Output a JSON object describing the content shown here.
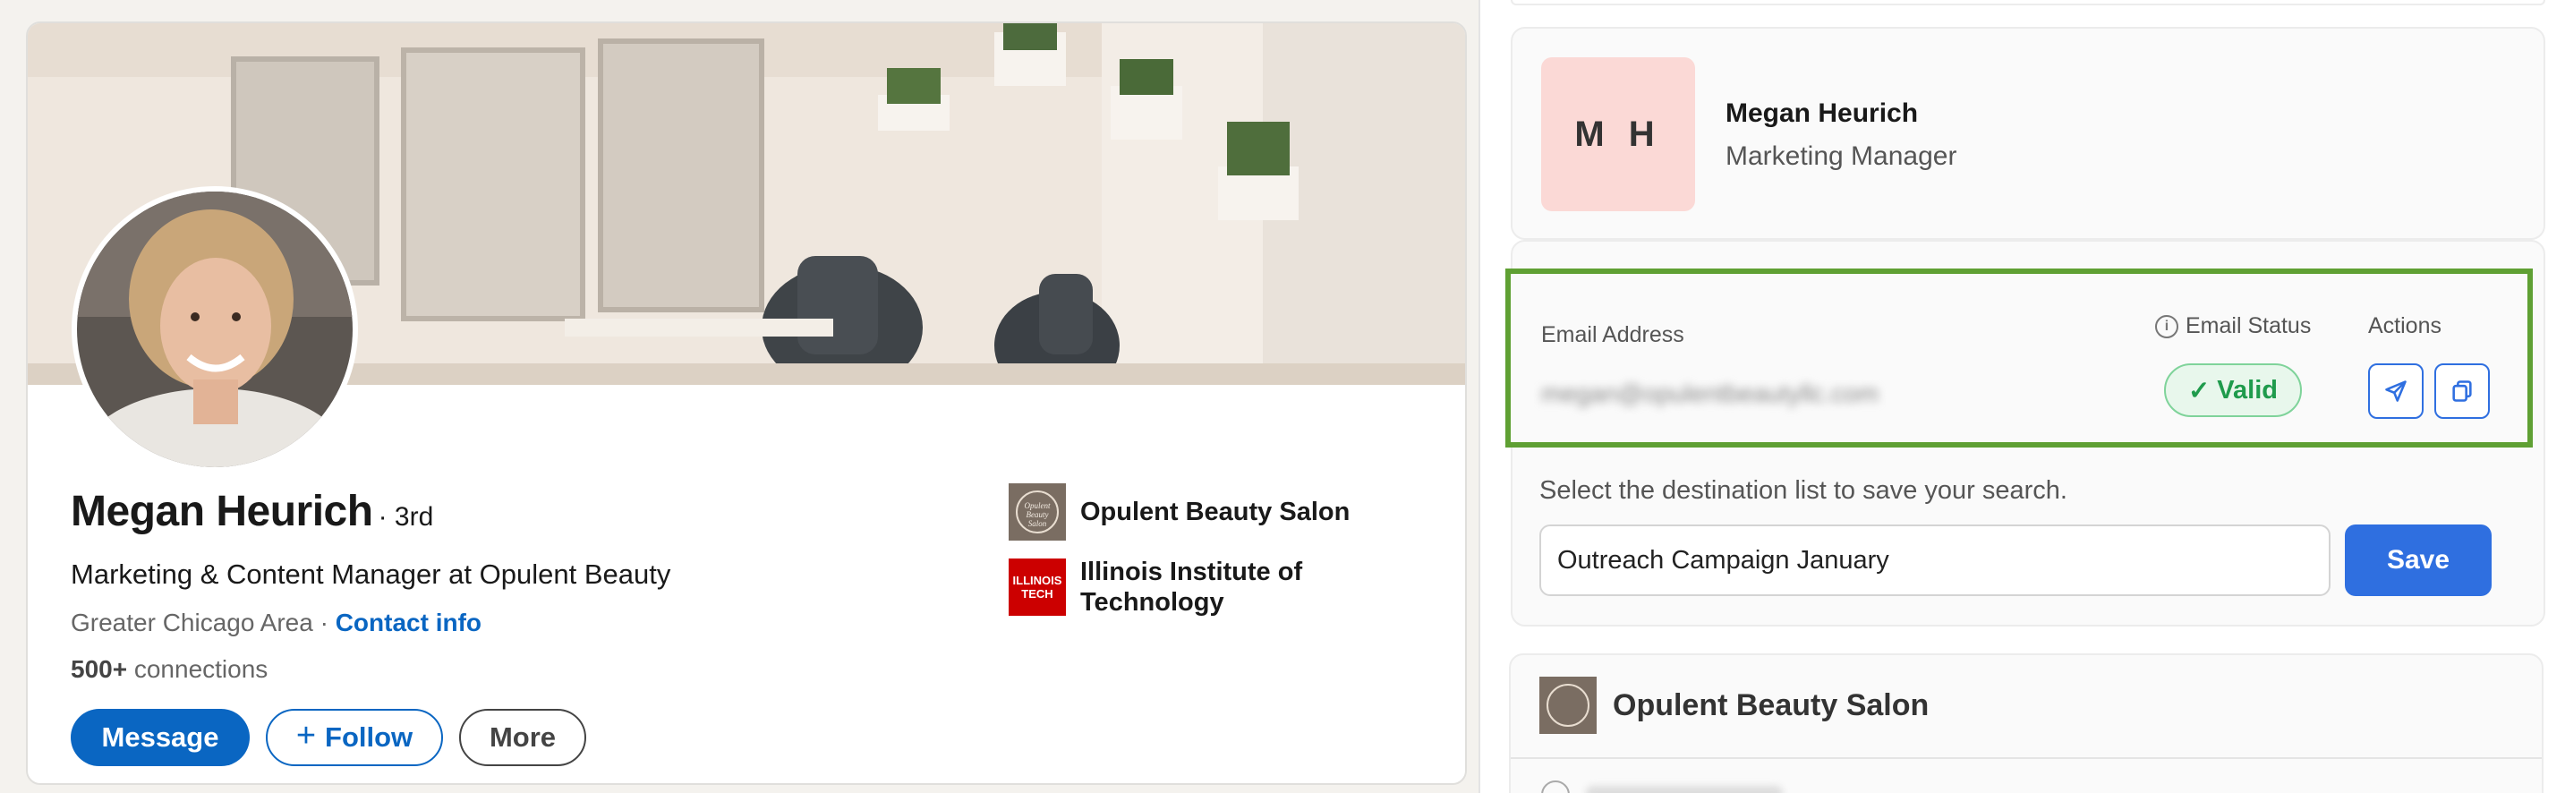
{
  "profile": {
    "name": "Megan Heurich",
    "degree": "· 3rd",
    "headline": "Marketing & Content Manager at Opulent Beauty",
    "location": "Greater Chicago Area ·",
    "contact_info": "Contact info",
    "connections_count": "500+",
    "connections_label": "connections",
    "buttons": {
      "message": "Message",
      "follow": "Follow",
      "more": "More"
    },
    "organizations": [
      {
        "name": "Opulent Beauty Salon",
        "logo_text": "Opulent Beauty Salon"
      },
      {
        "name_line1": "Illinois Institute of",
        "name_line2": "Technology",
        "logo_text_1": "ILLINOIS",
        "logo_text_2": "TECH"
      }
    ]
  },
  "panel": {
    "contact": {
      "initials": "M H",
      "name": "Megan Heurich",
      "title": "Marketing Manager"
    },
    "email": {
      "label": "Email Address",
      "value": "megan@opulentbeautyllc.com",
      "status_label": "Email Status",
      "status": "Valid",
      "actions_label": "Actions"
    },
    "destination": {
      "label": "Select the destination list to save your search.",
      "list_value": "Outreach Campaign January",
      "save": "Save"
    },
    "company": {
      "name": "Opulent Beauty Salon"
    }
  },
  "colors": {
    "linkedin_blue": "#0a66c2",
    "highlight_green": "#5fa033",
    "valid_green": "#1f9b4c",
    "save_blue": "#2f6fe0",
    "initials_bg": "#fbd9d6"
  }
}
